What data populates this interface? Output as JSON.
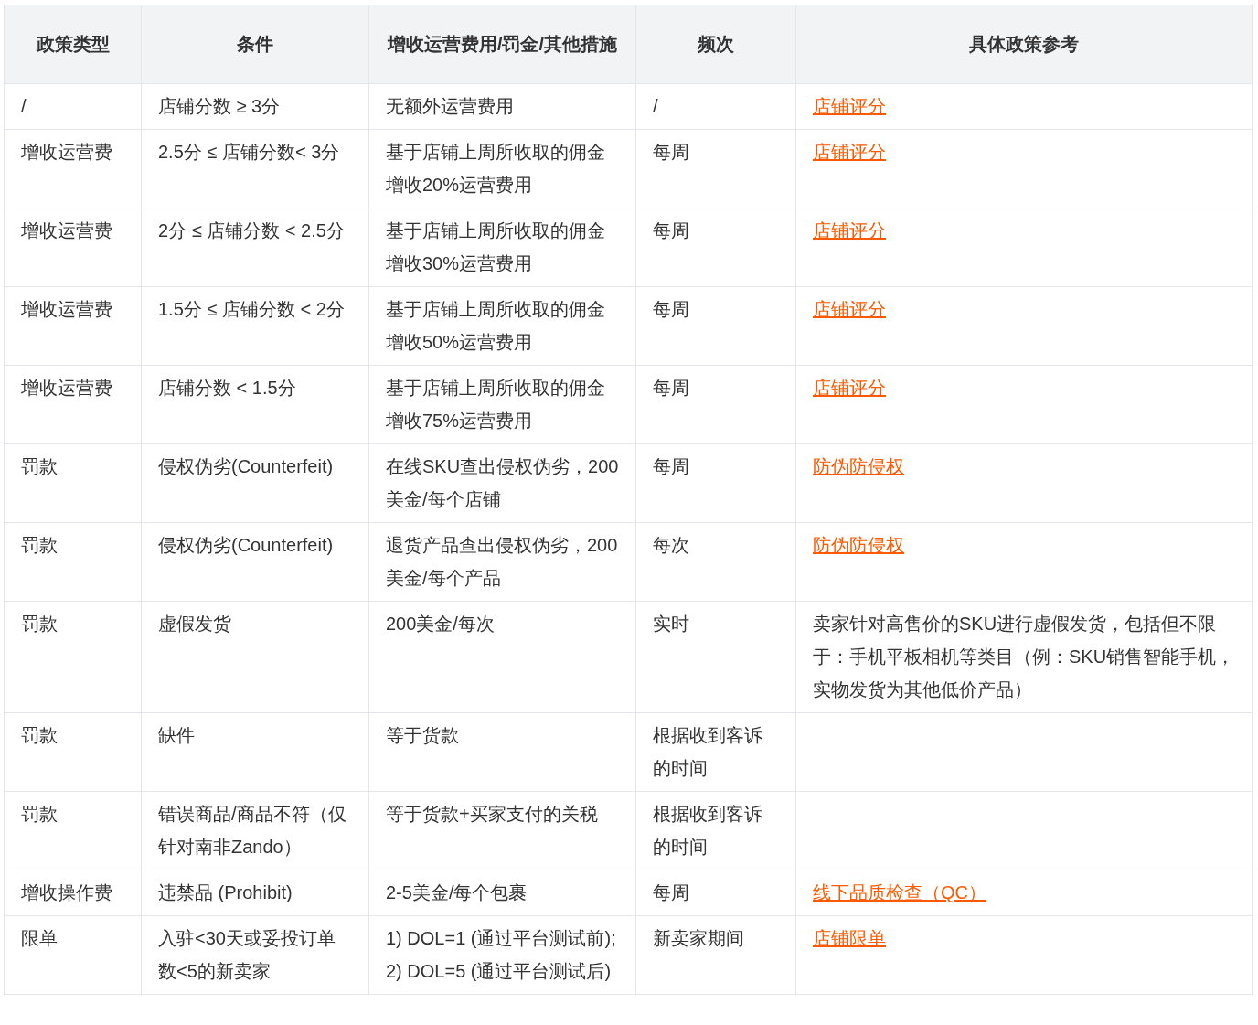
{
  "table": {
    "columns": [
      "政策类型",
      "条件",
      "增收运营费用/罚金/其他措施",
      "频次",
      "具体政策参考"
    ],
    "rows": [
      {
        "type": "/",
        "condition": "店铺分数 ≥ 3分",
        "measure": "无额外运营费用",
        "frequency": "/",
        "reference": {
          "kind": "link",
          "text": "店铺评分"
        }
      },
      {
        "type": "增收运营费",
        "condition": "2.5分 ≤ 店铺分数< 3分",
        "measure": "基于店铺上周所收取的佣金增收20%运营费用",
        "frequency": "每周",
        "reference": {
          "kind": "link",
          "text": "店铺评分"
        }
      },
      {
        "type": "增收运营费",
        "condition": "2分 ≤ 店铺分数 < 2.5分",
        "measure": "基于店铺上周所收取的佣金增收30%运营费用",
        "frequency": "每周",
        "reference": {
          "kind": "link",
          "text": "店铺评分"
        }
      },
      {
        "type": "增收运营费",
        "condition": "1.5分 ≤ 店铺分数 < 2分",
        "measure": "基于店铺上周所收取的佣金增收50%运营费用",
        "frequency": "每周",
        "reference": {
          "kind": "link",
          "text": "店铺评分"
        }
      },
      {
        "type": "增收运营费",
        "condition": "店铺分数 < 1.5分",
        "measure": "基于店铺上周所收取的佣金增收75%运营费用",
        "frequency": "每周",
        "reference": {
          "kind": "link",
          "text": "店铺评分"
        }
      },
      {
        "type": "罚款",
        "condition": "侵权伪劣(Counterfeit)",
        "measure": "在线SKU查出侵权伪劣，200美金/每个店铺",
        "frequency": "每周",
        "reference": {
          "kind": "link",
          "text": "防伪防侵权"
        }
      },
      {
        "type": "罚款",
        "condition": "侵权伪劣(Counterfeit)",
        "measure": "退货产品查出侵权伪劣，200美金/每个产品",
        "frequency": "每次",
        "reference": {
          "kind": "link",
          "text": "防伪防侵权"
        }
      },
      {
        "type": "罚款",
        "condition": "虚假发货",
        "measure": "200美金/每次",
        "frequency": "实时",
        "reference": {
          "kind": "text",
          "text": "卖家针对高售价的SKU进行虚假发货，包括但不限于：手机平板相机等类目（例：SKU销售智能手机，实物发货为其他低价产品）"
        }
      },
      {
        "type": "罚款",
        "condition": "缺件",
        "measure": "等于货款",
        "frequency": "根据收到客诉的时间"
      },
      {
        "type": "罚款",
        "condition": "错误商品/商品不符（仅针对南非Zando）",
        "measure": "等于货款+买家支付的关税",
        "frequency": "根据收到客诉的时间"
      },
      {
        "type": "增收操作费",
        "condition": "违禁品 (Prohibit)",
        "measure": "2-5美金/每个包裹",
        "frequency": "每周",
        "reference": {
          "kind": "link",
          "text": "线下品质检查（QC）"
        }
      },
      {
        "type": "限单",
        "condition": "入驻<30天或妥投订单数<5的新卖家",
        "measure": "1) DOL=1 (通过平台测试前); 2) DOL=5 (通过平台测试后)",
        "frequency": "新卖家期间",
        "reference": {
          "kind": "link",
          "text": "店铺限单"
        }
      }
    ]
  }
}
